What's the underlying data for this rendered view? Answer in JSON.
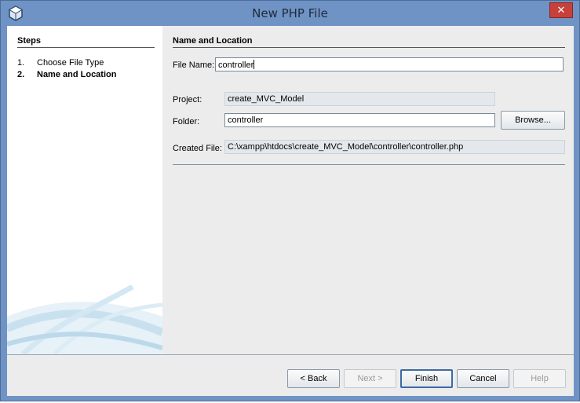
{
  "window": {
    "title": "New PHP File",
    "close_icon": "close-icon"
  },
  "sidebar": {
    "heading": "Steps",
    "steps": [
      {
        "num": "1.",
        "label": "Choose File Type"
      },
      {
        "num": "2.",
        "label": "Name and Location"
      }
    ]
  },
  "main": {
    "heading": "Name and Location",
    "file_name_label": "File Name:",
    "file_name_value": "controller",
    "project_label": "Project:",
    "project_value": "create_MVC_Model",
    "folder_label": "Folder:",
    "folder_value": "controller",
    "browse_label": "Browse...",
    "created_file_label": "Created File:",
    "created_file_value": "C:\\xampp\\htdocs\\create_MVC_Model\\controller\\controller.php"
  },
  "footer": {
    "back_label": "< Back",
    "next_label": "Next >",
    "finish_label": "Finish",
    "cancel_label": "Cancel",
    "help_label": "Help"
  }
}
